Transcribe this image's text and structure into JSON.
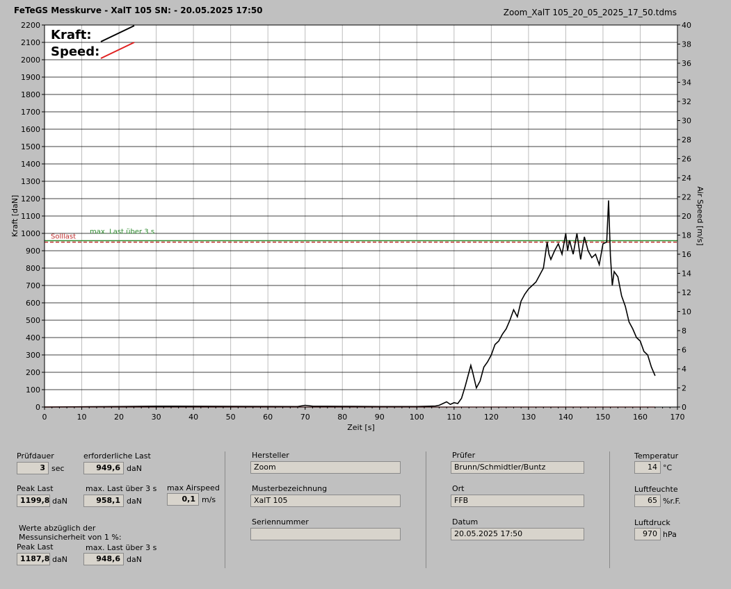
{
  "header": {
    "title": "FeTeGS Messkurve - XalT 105  SN:  - 20.05.2025 17:50",
    "file": "Zoom_XalT 105_20_05_2025_17_50.tdms"
  },
  "chart_data": {
    "type": "line",
    "xlabel": "Zeit [s]",
    "ylabel": "Kraft [daN]",
    "y2label": "Air Speed [m/s]",
    "xlim": [
      0,
      170
    ],
    "ylim": [
      0,
      2200
    ],
    "y2lim": [
      0,
      40
    ],
    "x_ticks": [
      0,
      10,
      20,
      30,
      40,
      50,
      60,
      70,
      80,
      90,
      100,
      110,
      120,
      130,
      140,
      150,
      160,
      170
    ],
    "y_ticks": [
      0,
      100,
      200,
      300,
      400,
      500,
      600,
      700,
      800,
      900,
      1000,
      1100,
      1200,
      1300,
      1400,
      1500,
      1600,
      1700,
      1800,
      1900,
      2000,
      2100,
      2200
    ],
    "y2_ticks": [
      0,
      2,
      4,
      6,
      8,
      10,
      12,
      14,
      16,
      18,
      20,
      22,
      24,
      26,
      28,
      30,
      32,
      34,
      36,
      38,
      40
    ],
    "grid": true,
    "legend": {
      "placement": "top-left",
      "entries": [
        {
          "name": "Kraft:",
          "color": "#000000"
        },
        {
          "name": "Speed:",
          "color": "#e02020"
        }
      ]
    },
    "reference_lines": [
      {
        "label": "Solllast",
        "value": 949.6,
        "color": "#c03030",
        "style": "dashed"
      },
      {
        "label": "max. Last über  3 s",
        "value": 958.1,
        "color": "#2e8b2e",
        "style": "solid"
      }
    ],
    "series": [
      {
        "name": "Kraft",
        "color": "#000000",
        "x": [
          0,
          20,
          30,
          50,
          68,
          70,
          72,
          80,
          90,
          100,
          105,
          106,
          107,
          108,
          109,
          110,
          111,
          112,
          113,
          114,
          114.5,
          115,
          116,
          117,
          118,
          119,
          120,
          121,
          122,
          123,
          124,
          125,
          126,
          127,
          128,
          129,
          130,
          131,
          132,
          133,
          134,
          135,
          135.5,
          136,
          137,
          138,
          139,
          140,
          140.5,
          141,
          142,
          143,
          144,
          145,
          146,
          147,
          148,
          149,
          150,
          151,
          151.5,
          152,
          152.5,
          153,
          154,
          155,
          156,
          157,
          158,
          159,
          160,
          161,
          162,
          163,
          164
        ],
        "values": [
          0,
          3,
          5,
          4,
          3,
          10,
          5,
          4,
          3,
          3,
          6,
          10,
          20,
          30,
          15,
          25,
          20,
          50,
          120,
          200,
          240,
          200,
          110,
          150,
          230,
          260,
          300,
          360,
          380,
          420,
          450,
          500,
          560,
          520,
          610,
          650,
          680,
          700,
          720,
          760,
          800,
          950,
          880,
          850,
          900,
          940,
          880,
          1000,
          900,
          960,
          880,
          1000,
          850,
          980,
          900,
          860,
          880,
          820,
          940,
          950,
          1190,
          870,
          700,
          780,
          750,
          640,
          580,
          490,
          450,
          400,
          380,
          320,
          300,
          230,
          180
        ]
      },
      {
        "name": "Speed",
        "color": "#e02020",
        "x": [
          0,
          120,
          164
        ],
        "values": [
          0,
          0,
          0
        ]
      }
    ]
  },
  "panel": {
    "pruefdauer_label": "Prüfdauer",
    "pruefdauer_value": "3",
    "pruefdauer_unit": "sec",
    "erf_last_label": "erforderliche Last",
    "erf_last_value": "949,6",
    "erf_last_unit": "daN",
    "peak_last_label": "Peak Last",
    "peak_last_value": "1199,8",
    "peak_last_unit": "daN",
    "max_last_label": "max. Last über  3 s",
    "max_last_value": "958,1",
    "max_last_unit": "daN",
    "max_airspeed_label": "max Airspeed",
    "max_airspeed_value": "0,1",
    "max_airspeed_unit": "m/s",
    "werte_note": "Werte abzüglich der\nMessunsicherheit von 1  %:",
    "peak_last2_label": "Peak Last",
    "peak_last2_value": "1187,8",
    "peak_last2_unit": "daN",
    "max_last2_label": "max. Last über  3 s",
    "max_last2_value": "948,6",
    "max_last2_unit": "daN",
    "hersteller_label": "Hersteller",
    "hersteller_value": "Zoom",
    "muster_label": "Musterbezeichnung",
    "muster_value": "XalT 105",
    "serien_label": "Seriennummer",
    "serien_value": "",
    "pruefer_label": "Prüfer",
    "pruefer_value": "Brunn/Schmidtler/Buntz",
    "ort_label": "Ort",
    "ort_value": "FFB",
    "datum_label": "Datum",
    "datum_value": "20.05.2025 17:50",
    "temp_label": "Temperatur",
    "temp_value": "14",
    "temp_unit": "°C",
    "feuchte_label": "Luftfeuchte",
    "feuchte_value": "65",
    "feuchte_unit": "%r.F.",
    "druck_label": "Luftdruck",
    "druck_value": "970",
    "druck_unit": "hPa"
  }
}
